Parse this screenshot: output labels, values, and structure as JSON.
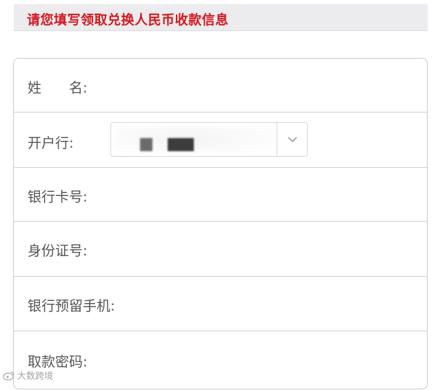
{
  "notice": {
    "text": "请您填写领取兑换人民币收款信息"
  },
  "form": {
    "fields": [
      {
        "label": "姓　　名:",
        "name": "name-field"
      },
      {
        "label": "开户行:",
        "name": "bank-select"
      },
      {
        "label": "银行卡号:",
        "name": "card-number-field"
      },
      {
        "label": "身份证号:",
        "name": "id-number-field"
      },
      {
        "label": "银行预留手机:",
        "name": "phone-field"
      },
      {
        "label": "取款密码:",
        "name": "password-field"
      }
    ],
    "bank_select_icon": "chevron-down-icon"
  },
  "watermark": {
    "text": "大数跨境",
    "icon": "weibo-icon"
  },
  "colors": {
    "notice_text": "#d4171d",
    "notice_bg": "#ececef",
    "border": "#cdcdcd",
    "label": "#555555"
  }
}
